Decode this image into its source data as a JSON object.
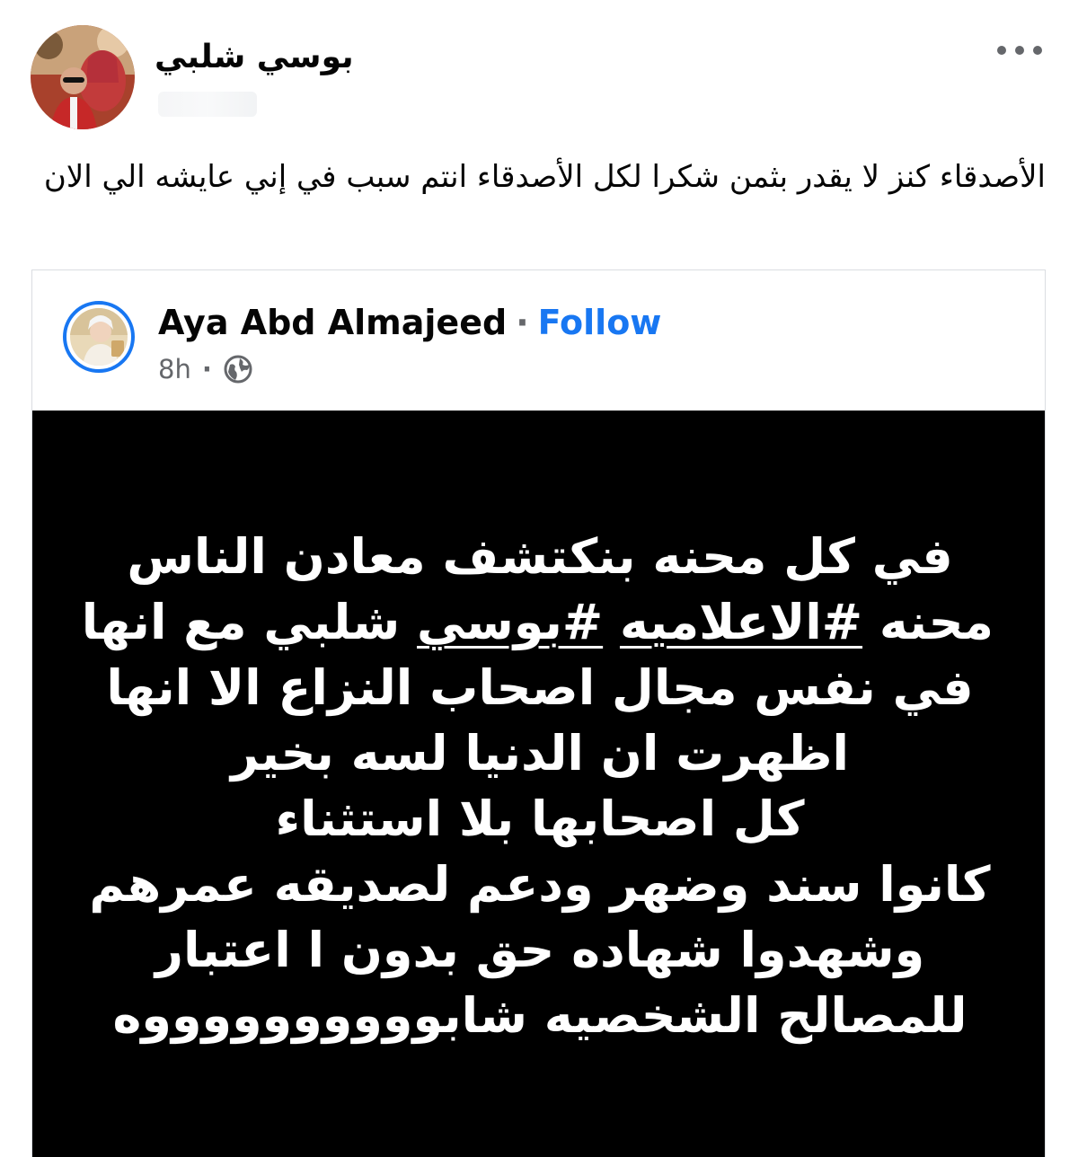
{
  "post": {
    "author": "بوسي شلبي",
    "caption": "الأصدقاء كنز لا يقدر بثمن شكرا لكل الأصدقاء انتم سبب في إني عايشه الي الان",
    "more_icon": "more-horizontal-icon"
  },
  "shared_post": {
    "author": "Aya Abd Almajeed",
    "separator": "·",
    "follow_label": "Follow",
    "time": "8h",
    "meta_separator": "·",
    "audience_icon": "globe-icon",
    "quote": {
      "line1": "في كل محنه بنكتشف معادن الناس",
      "line2_a": "محنه ",
      "line2_hashtag1": "#الاعلاميه",
      "line2_b": " ",
      "line2_hashtag2": "#بوسي",
      "line2_c": " شلبي مع انها",
      "line3": "في نفس  مجال  اصحاب النزاع الا انها",
      "line4": "اظهرت ان الدنيا لسه بخير",
      "line5": "كل اصحابها بلا استثناء",
      "line6": "كانوا سند وضهر ودعم لصديقه عمرهم",
      "line7": "وشهدوا شهاده حق بدون ا اعتبار",
      "line8": "للمصالح  الشخصيه شابووووووووووه"
    }
  },
  "colors": {
    "link_blue": "#1877f2",
    "secondary_text": "#65676b",
    "image_background": "#000000",
    "image_text": "#ffffff"
  }
}
